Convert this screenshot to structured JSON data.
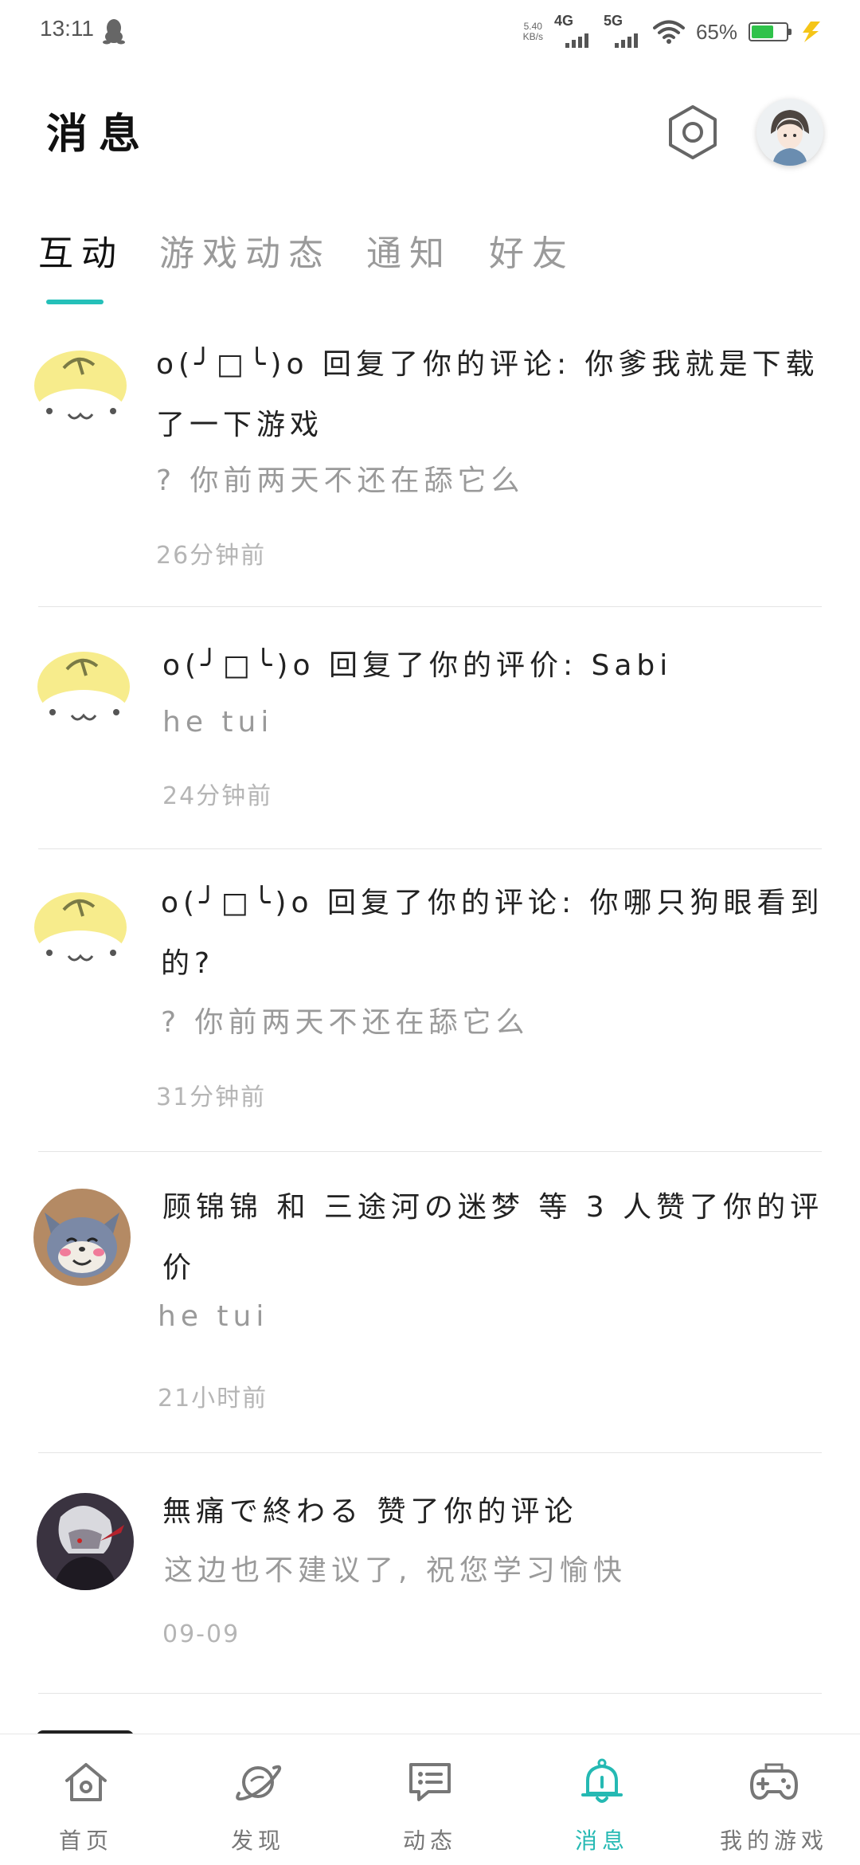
{
  "status_bar": {
    "time": "13:11",
    "net_speed_value": "5.40",
    "net_speed_unit": "KB/s",
    "signal_1": "4G",
    "signal_2": "5G",
    "battery_percent": "65%",
    "battery_level": 0.65,
    "battery_color": "#2fc24a"
  },
  "header": {
    "title": "消息",
    "settings_icon": "hexagon-settings-icon",
    "avatar_icon": "user-avatar"
  },
  "tabs": [
    {
      "label": "互动",
      "active": true
    },
    {
      "label": "游戏动态",
      "active": false
    },
    {
      "label": "通知",
      "active": false
    },
    {
      "label": "好友",
      "active": false
    }
  ],
  "accent_color": "#25c0b9",
  "messages": [
    {
      "avatar": "lemon-cat-avatar",
      "title": "o(╯□╰)o 回复了你的评论: 你爹我就是下载了一下游戏",
      "body": "? 你前两天不还在舔它么",
      "time": "26分钟前"
    },
    {
      "avatar": "lemon-cat-avatar",
      "title": "o(╯□╰)o 回复了你的评价: Sabi",
      "body": "he  tui",
      "time": "24分钟前"
    },
    {
      "avatar": "lemon-cat-avatar",
      "title": "o(╯□╰)o 回复了你的评论: 你哪只狗眼看到的?",
      "body": "? 你前两天不还在舔它么",
      "time": "31分钟前"
    },
    {
      "avatar": "tom-cat-avatar",
      "title": "顾锦锦 和 三途河の迷梦 等 3 人赞了你的评价",
      "body": "he  tui",
      "time": "21小时前"
    },
    {
      "avatar": "dark-character-avatar",
      "title": "無痛で終わる 赞了你的评论",
      "body": "这边也不建议了, 祝您学习愉快",
      "time": "09-09"
    }
  ],
  "bottom_nav": [
    {
      "label": "首页",
      "icon": "home-icon",
      "active": false
    },
    {
      "label": "发现",
      "icon": "planet-icon",
      "active": false
    },
    {
      "label": "动态",
      "icon": "feed-icon",
      "active": false
    },
    {
      "label": "消息",
      "icon": "bell-icon",
      "active": true
    },
    {
      "label": "我的游戏",
      "icon": "gamepad-icon",
      "active": false
    }
  ]
}
